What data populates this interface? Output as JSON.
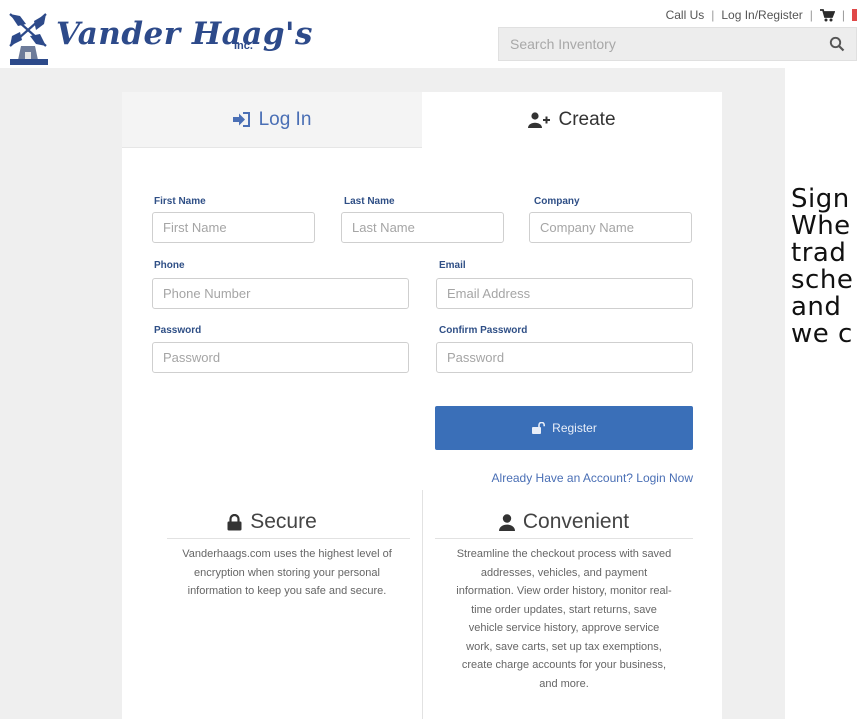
{
  "brand": {
    "name": "Vander Haag's",
    "suffix": "Inc.",
    "logo_icon": "windmill-icon"
  },
  "header": {
    "call_us": "Call Us",
    "login_register": "Log In/Register",
    "cart_icon": "cart-icon",
    "search_placeholder": "Search Inventory",
    "search_icon": "search-icon"
  },
  "tabs": {
    "login": {
      "label": "Log In",
      "icon": "sign-in-icon"
    },
    "create": {
      "label": "Create",
      "icon": "add-user-icon"
    }
  },
  "form": {
    "first_name": {
      "label": "First Name",
      "placeholder": "First Name"
    },
    "last_name": {
      "label": "Last Name",
      "placeholder": "Last Name"
    },
    "company": {
      "label": "Company",
      "placeholder": "Company Name"
    },
    "phone": {
      "label": "Phone",
      "placeholder": "Phone Number"
    },
    "email": {
      "label": "Email",
      "placeholder": "Email Address"
    },
    "password": {
      "label": "Password",
      "placeholder": "Password"
    },
    "confirm_password": {
      "label": "Confirm Password",
      "placeholder": "Password"
    },
    "register_label": "Register",
    "register_icon": "unlock-icon",
    "already_have_account": "Already Have an Account? Login Now"
  },
  "features": {
    "secure": {
      "title": "Secure",
      "icon": "lock-icon",
      "lines": [
        "Vanderhaags.com uses the highest level of",
        "encryption when storing your personal",
        "information to keep you safe and secure."
      ]
    },
    "convenient": {
      "title": "Convenient",
      "icon": "user-icon",
      "lines": [
        "Streamline the checkout process with saved",
        "addresses, vehicles, and payment",
        "information. View order history, monitor real-",
        "time order updates, start returns, save",
        "vehicle service history, approve service",
        "work, save carts, set up tax exemptions,",
        "create charge accounts for your business,",
        "and more."
      ]
    }
  },
  "side_note": {
    "lines": [
      "Sign",
      "Whe",
      "trad",
      "sche",
      "and",
      "we c"
    ]
  },
  "colors": {
    "brand_blue": "#2d4a8a",
    "link_blue": "#4a6fb5",
    "button_blue": "#3a6fb8",
    "page_gray": "#efefef"
  }
}
